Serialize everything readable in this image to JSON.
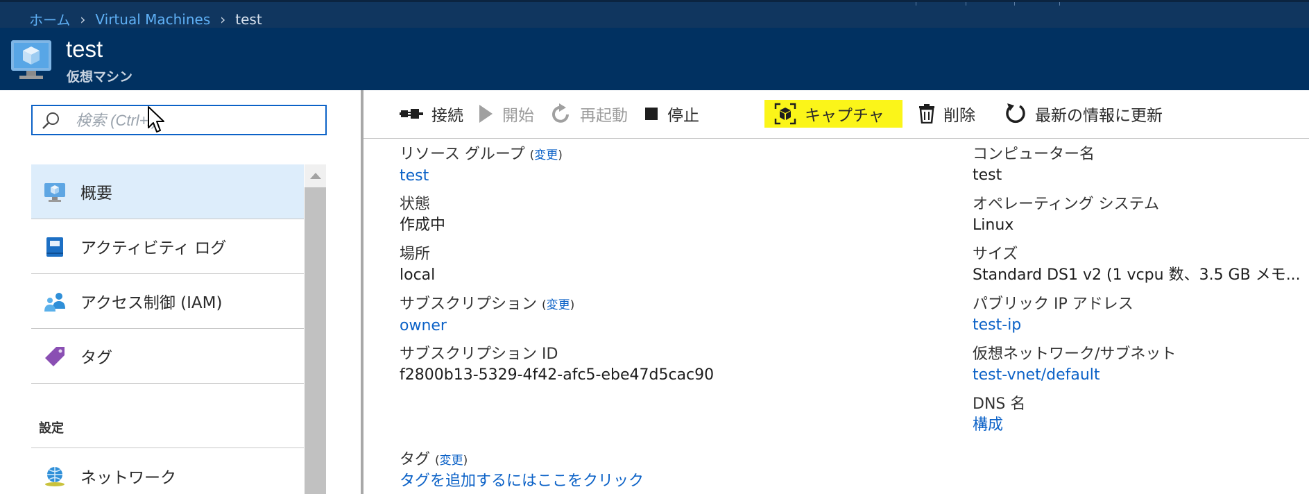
{
  "breadcrumb": {
    "home": "ホーム",
    "vms": "Virtual Machines",
    "current": "test"
  },
  "header": {
    "title": "test",
    "subtitle": "仮想マシン"
  },
  "search": {
    "placeholder": "検索 (Ctrl+/)"
  },
  "sidebar": {
    "items": [
      {
        "label": "概要",
        "icon": "vm-overview-icon"
      },
      {
        "label": "アクティビティ ログ",
        "icon": "activity-log-icon"
      },
      {
        "label": "アクセス制御 (IAM)",
        "icon": "iam-icon"
      },
      {
        "label": "タグ",
        "icon": "tag-icon"
      }
    ],
    "section_settings": "設定",
    "settings_items": [
      {
        "label": "ネットワーク",
        "icon": "network-icon"
      }
    ]
  },
  "toolbar": {
    "connect": "接続",
    "start": "開始",
    "restart": "再起動",
    "stop": "停止",
    "capture": "キャプチャ",
    "delete": "削除",
    "refresh": "最新の情報に更新"
  },
  "essentials": {
    "change_label": "変更",
    "resource_group_label": "リソース グループ",
    "resource_group": "test",
    "status_label": "状態",
    "status": "作成中",
    "location_label": "場所",
    "location": "local",
    "subscription_label": "サブスクリプション",
    "subscription": "owner",
    "subscription_id_label": "サブスクリプション ID",
    "subscription_id": "f2800b13-5329-4f42-afc5-ebe47d5cac90",
    "computer_name_label": "コンピューター名",
    "computer_name": "test",
    "os_label": "オペレーティング システム",
    "os": "Linux",
    "size_label": "サイズ",
    "size": "Standard DS1 v2 (1 vcpu 数、3.5 GB メモ...",
    "public_ip_label": "パブリック IP アドレス",
    "public_ip": "test-ip",
    "vnet_label": "仮想ネットワーク/サブネット",
    "vnet": "test-vnet/default",
    "dns_label": "DNS 名",
    "dns": "構成",
    "tags_label": "タグ",
    "tags_add": "タグを追加するにはここをクリック"
  },
  "colors": {
    "topbar": "#10365f",
    "header": "#013161",
    "link": "#0c62c7",
    "highlight": "#fbf519",
    "selected": "#ddedfb"
  }
}
